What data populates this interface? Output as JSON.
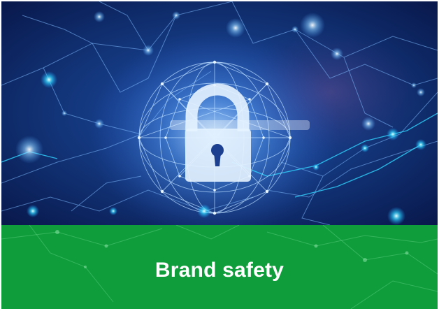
{
  "banner": {
    "title": "Brand safety",
    "color": "#0f9d3c"
  },
  "hero": {
    "icon": "padlock-icon",
    "background_color": "#0a1c4e",
    "accent_color": "#4aa8ff"
  }
}
